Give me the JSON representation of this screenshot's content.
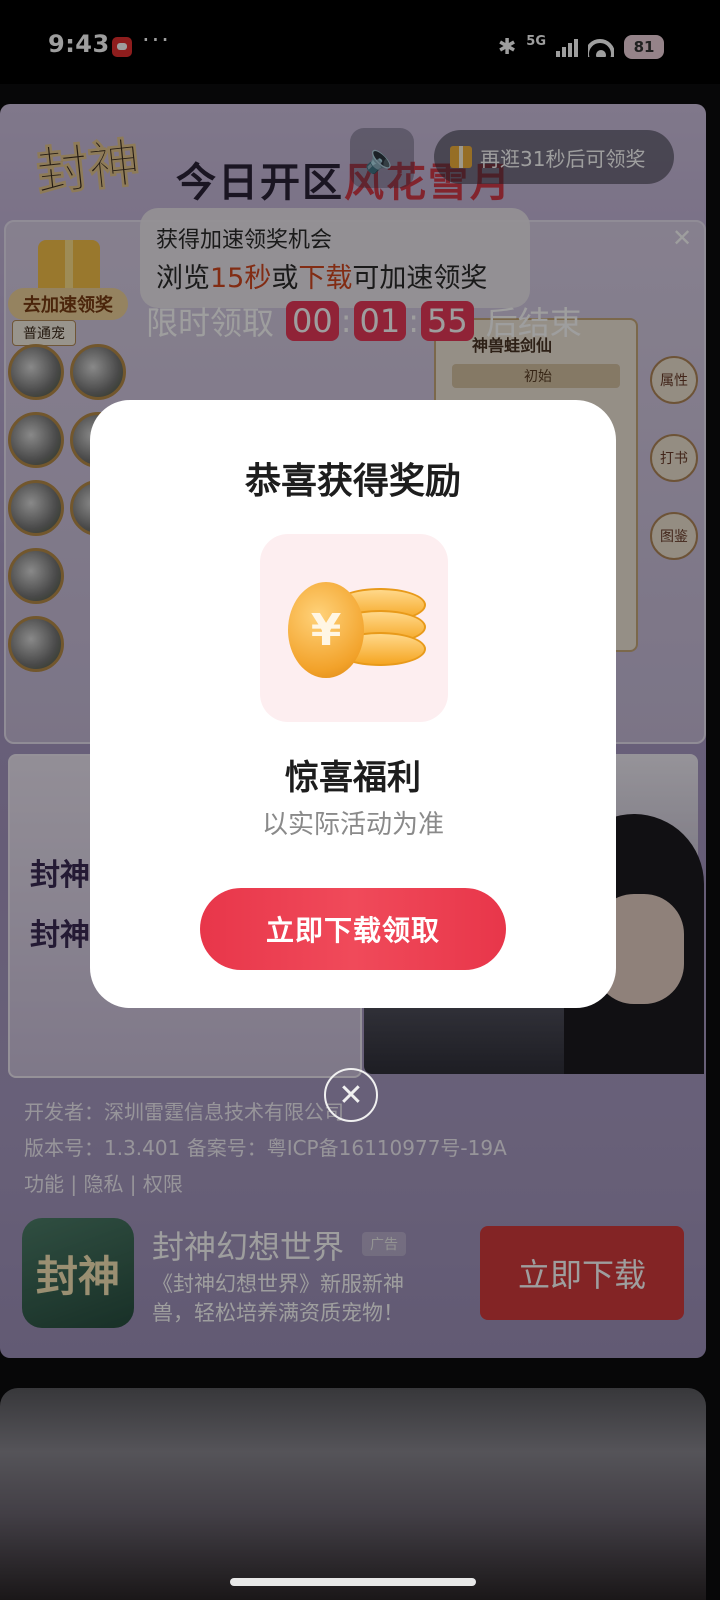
{
  "status_bar": {
    "time": "9:43",
    "more": "···",
    "network": "5G",
    "wifi_sub": "6",
    "battery": "81"
  },
  "ad": {
    "logo_text": "封神",
    "banner_text_a": "今日开区",
    "banner_text_b": "风花雪月",
    "reward_pill": "再逛31秒后可领奖",
    "speedup": {
      "line1": "获得加速领奖机会",
      "line2_a": "浏览",
      "line2_b": "15秒",
      "line2_c": "或",
      "line2_d": "下载",
      "line2_e": "可加速领奖",
      "gift_label": "去加速领奖"
    },
    "timer": {
      "prefix": "限时领取",
      "hh": "00",
      "mm": "01",
      "ss": "55",
      "suffix": "后结束"
    },
    "game": {
      "tab_label": "普通宠",
      "pet_panel_title": "神兽蛙剑仙",
      "pet_nav": "初始",
      "side_btns": [
        "属性",
        "打书",
        "图鉴"
      ],
      "lower_left_lines": [
        "封神",
        "封神"
      ]
    },
    "developer": "开发者：深圳雷霆信息技术有限公司",
    "version": "版本号：1.3.401   备案号：粤ICP备16110977号-19A",
    "links": "功能 | 隐私 | 权限",
    "app": {
      "icon_text": "封神",
      "name": "封神幻想世界",
      "badge": "广告",
      "desc": "《封神幻想世界》新服新神兽，轻松培养满资质宠物！",
      "download": "立即下载"
    }
  },
  "modal": {
    "title": "恭喜获得奖励",
    "prize": "惊喜福利",
    "note": "以实际活动为准",
    "button": "立即下载领取",
    "coin_symbol": "¥"
  },
  "colors": {
    "accent_red": "#e8364a",
    "timer_red": "#e9395a",
    "download_red": "#d43a3d"
  }
}
